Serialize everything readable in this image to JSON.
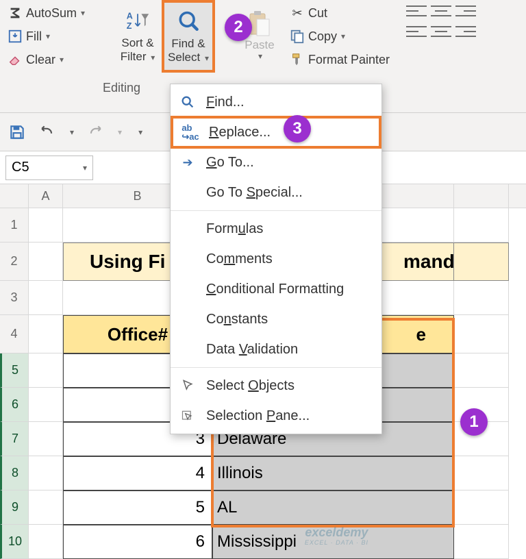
{
  "ribbon": {
    "autosum": "AutoSum",
    "fill": "Fill",
    "clear": "Clear",
    "sort_filter_l1": "Sort &",
    "sort_filter_l2": "Filter",
    "find_select_l1": "Find &",
    "find_select_l2": "Select",
    "paste": "Paste",
    "cut": "Cut",
    "copy": "Copy",
    "format_painter": "Format Painter",
    "group_editing": "Editing"
  },
  "namebox": "C5",
  "menu": {
    "find": "Find...",
    "replace": "Replace...",
    "goto": "Go To...",
    "gotospecial": "Go To Special...",
    "formulas": "Formulas",
    "comments": "Comments",
    "cond": "Conditional Formatting",
    "constants": "Constants",
    "datavalidation": "Data Validation",
    "selectobjects": "Select Objects",
    "selectionpane": "Selection Pane..."
  },
  "sheet": {
    "title_left": "Using Fi",
    "title_right": "mand",
    "header_office": "Office#",
    "header_state_frag": "e",
    "rows": [
      {
        "num": "",
        "state": ""
      },
      {
        "num": "",
        "state": ""
      },
      {
        "num": "3",
        "state": "Delaware"
      },
      {
        "num": "4",
        "state": "Illinois"
      },
      {
        "num": "5",
        "state": "AL"
      },
      {
        "num": "6",
        "state": "Mississippi"
      }
    ]
  },
  "badges": {
    "b1": "1",
    "b2": "2",
    "b3": "3"
  },
  "cols": [
    "A",
    "B"
  ],
  "row_nums": [
    "1",
    "2",
    "3",
    "4",
    "5",
    "6",
    "7",
    "8",
    "9",
    "10"
  ],
  "watermark": {
    "brand": "exceldemy",
    "tag": "EXCEL · DATA · BI"
  }
}
